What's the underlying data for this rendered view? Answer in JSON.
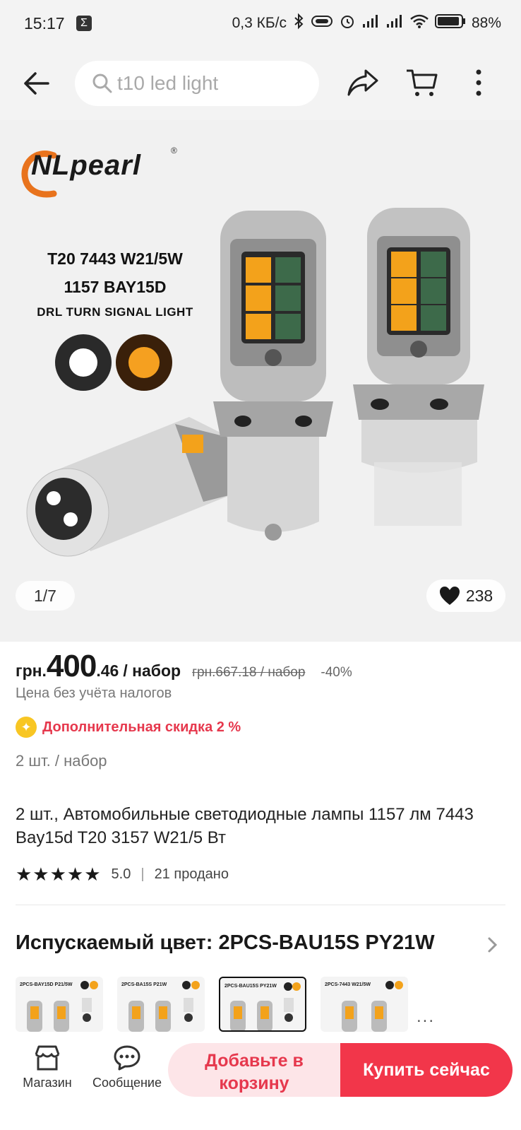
{
  "status_bar": {
    "time": "15:17",
    "net_speed": "0,3 КБ/с",
    "battery": "88%"
  },
  "header": {
    "search_placeholder": "t10 led light"
  },
  "gallery": {
    "brand": "NLpearl",
    "brand_mark": "®",
    "model_line1": "T20 7443 W21/5W",
    "model_line2": "1157 BAY15D",
    "desc": "DRL TURN SIGNAL LIGHT",
    "counter": "1/7",
    "likes": "238"
  },
  "price": {
    "currency": "грн.",
    "main": "400",
    "cents": ".46",
    "unit": "/ набор",
    "old_price": "грн.667.18 / набор",
    "discount": "-40%",
    "tax_note": "Цена без учёта налогов",
    "extra_discount": "Дополнительная скидка 2 %",
    "quantity": "2 шт. / набор"
  },
  "product": {
    "title": "2 шт., Автомобильные светодиодные лампы 1157 лм 7443 Bay15d T20 3157 W21/5 Вт",
    "rating": "5.0",
    "sold": "21 продано"
  },
  "variants": {
    "title": "Испускаемый цвет: 2PCS-BAU15S PY21W",
    "items": [
      {
        "label": "2PCS-BAY15D P21/5W"
      },
      {
        "label": "2PCS-BA15S P21W"
      },
      {
        "label": "2PCS-BAU15S PY21W"
      },
      {
        "label": "2PCS-7443 W21/5W"
      }
    ],
    "more": "..."
  },
  "bottom_bar": {
    "shop_label": "Магазин",
    "message_label": "Сообщение",
    "add_to_cart": "Добавьте в корзину",
    "buy_now": "Купить сейчас"
  },
  "colors": {
    "accent_red": "#e6384d",
    "buy_red": "#f2364a",
    "cart_pink": "#fde5e8",
    "bulb_amber": "#f3a21b"
  }
}
